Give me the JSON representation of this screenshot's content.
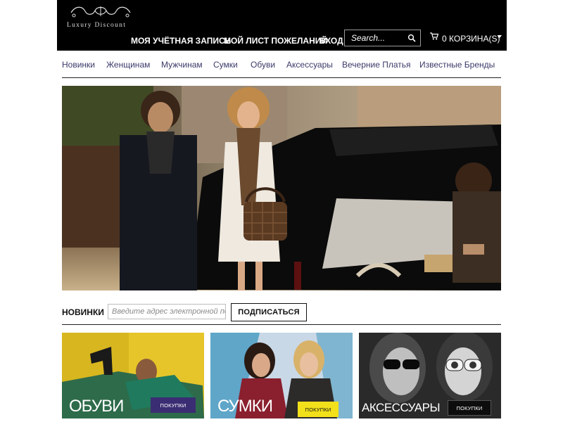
{
  "header": {
    "logo_text": "Luxury Discount",
    "nav": {
      "account": "МОЯ УЧЁТНАЯ ЗАПИСЬ",
      "wishlist": "МОЙ ЛИСТ ПОЖЕЛАНИЙ",
      "login": "ВХОД"
    },
    "search": {
      "placeholder": "Search..."
    },
    "cart": {
      "label": "0 КОРЗИНА(S)"
    }
  },
  "categories": [
    "Новинки",
    "Женщинам",
    "Мужчинам",
    "Сумки",
    "Обуви",
    "Аксессуары",
    "Вечерние Платья",
    "Известные Бренды"
  ],
  "newsletter": {
    "label": "НОВИНКИ",
    "placeholder": "Введите адрес электронной почты",
    "button": "ПОДПИСАТЬСЯ"
  },
  "tiles": [
    {
      "title": "ОБУВИ",
      "button": "ПОКУПКИ",
      "button_color": "#3b2d73",
      "button_text_color": "#ffffff"
    },
    {
      "title": "СУМКИ",
      "button": "ПОКУПКИ",
      "button_color": "#f2e01b",
      "button_text_color": "#111111"
    },
    {
      "title": "АКСЕССУАРЫ",
      "button": "ПОКУПКИ",
      "button_color": "#0d0d0d",
      "button_text_color": "#ffffff"
    }
  ],
  "colors": {
    "header_bg": "#000000",
    "menu_text": "#3a3a6a"
  },
  "icons": {
    "search": "search-icon",
    "cart": "cart-icon"
  }
}
